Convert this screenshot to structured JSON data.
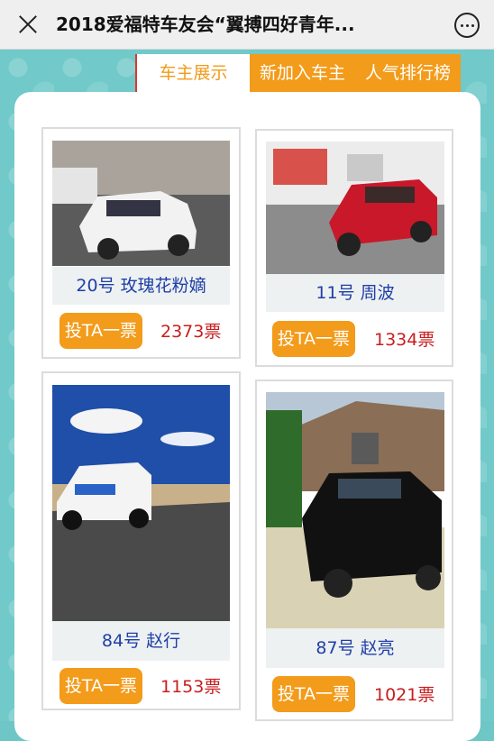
{
  "header": {
    "title": "2018爱福特车友会“翼搏四好青年..."
  },
  "tabs": [
    {
      "label": "车主展示",
      "active": true
    },
    {
      "label": "新加入车主",
      "active": false
    },
    {
      "label": "人气排行榜",
      "active": false
    }
  ],
  "cards": [
    {
      "caption": "20号 玫瑰花粉嫡",
      "vote_label": "投TA一票",
      "votes": "2373票",
      "car_color": "#f2f2f2"
    },
    {
      "caption": "11号 周波",
      "vote_label": "投TA一票",
      "votes": "1334票",
      "car_color": "#c9182a"
    },
    {
      "caption": "84号 赵行",
      "vote_label": "投TA一票",
      "votes": "1153票",
      "car_color": "#f4f4f4"
    },
    {
      "caption": "87号 赵亮",
      "vote_label": "投TA一票",
      "votes": "1021票",
      "car_color": "#111111"
    }
  ],
  "colors": {
    "accent": "#f39b1a",
    "background": "#71c9c9",
    "vote_count": "#c81e1e",
    "caption_text": "#1f3fa8"
  }
}
